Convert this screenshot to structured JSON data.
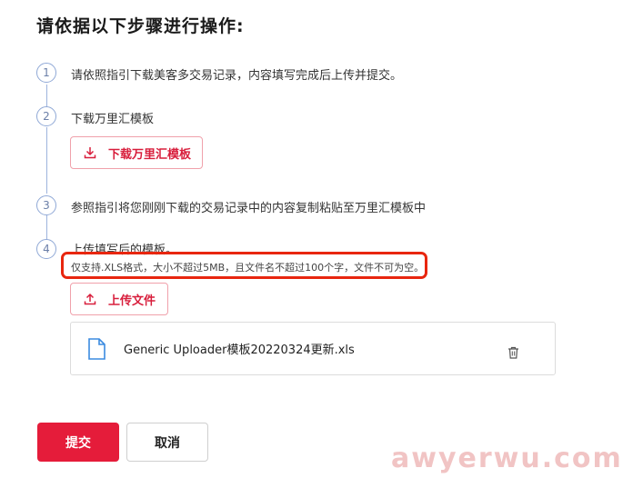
{
  "page_title": "请依据以下步骤进行操作:",
  "steps": [
    {
      "num": "1",
      "text": "请依照指引下载美客多交易记录，内容填写完成后上传并提交。"
    },
    {
      "num": "2",
      "text": "下载万里汇模板"
    },
    {
      "num": "3",
      "text": "参照指引将您刚刚下载的交易记录中的内容复制粘贴至万里汇模板中"
    },
    {
      "num": "4",
      "text": "上传填写后的模板。"
    }
  ],
  "download_button_label": "下载万里汇模板",
  "upload_hint": "仅支持.XLS格式，大小不超过5MB，且文件名不超过100个字，文件不可为空。",
  "upload_button_label": "上传文件",
  "uploaded_file": {
    "name": "Generic Uploader模板20220324更新.xls"
  },
  "submit_label": "提交",
  "cancel_label": "取消",
  "watermark": "awyerwu.com",
  "colors": {
    "accent": "#e51c3a",
    "step_border": "#8fa8d6",
    "highlight_box": "#e8260f"
  },
  "icons": {
    "download": "download-icon",
    "upload": "upload-icon",
    "file": "document-icon",
    "delete": "trash-icon"
  }
}
